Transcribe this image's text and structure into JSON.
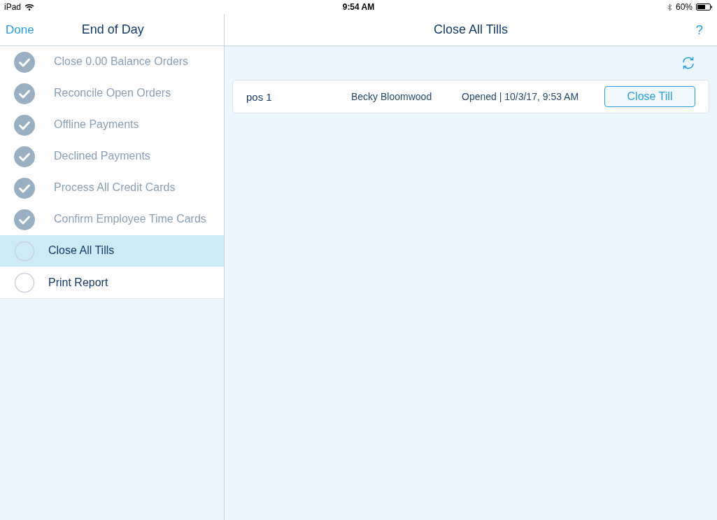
{
  "status_bar": {
    "device": "iPad",
    "time": "9:54 AM",
    "battery": "60%"
  },
  "sidebar": {
    "done_button": "Done",
    "title": "End of Day",
    "steps": [
      {
        "label": "Close 0.00 Balance Orders",
        "checked": true,
        "selected": false
      },
      {
        "label": "Reconcile Open Orders",
        "checked": true,
        "selected": false
      },
      {
        "label": "Offline Payments",
        "checked": true,
        "selected": false
      },
      {
        "label": "Declined Payments",
        "checked": true,
        "selected": false
      },
      {
        "label": "Process All Credit Cards",
        "checked": true,
        "selected": false
      },
      {
        "label": "Confirm Employee Time Cards",
        "checked": true,
        "selected": false
      },
      {
        "label": "Close All Tills",
        "checked": false,
        "selected": true
      },
      {
        "label": "Print Report",
        "checked": false,
        "selected": false
      }
    ]
  },
  "detail": {
    "title": "Close All Tills",
    "help_button": "?",
    "tills": [
      {
        "name": "pos 1",
        "employee": "Becky Bloomwood",
        "status": "Opened | 10/3/17, 9:53 AM",
        "action": "Close Till"
      }
    ]
  }
}
